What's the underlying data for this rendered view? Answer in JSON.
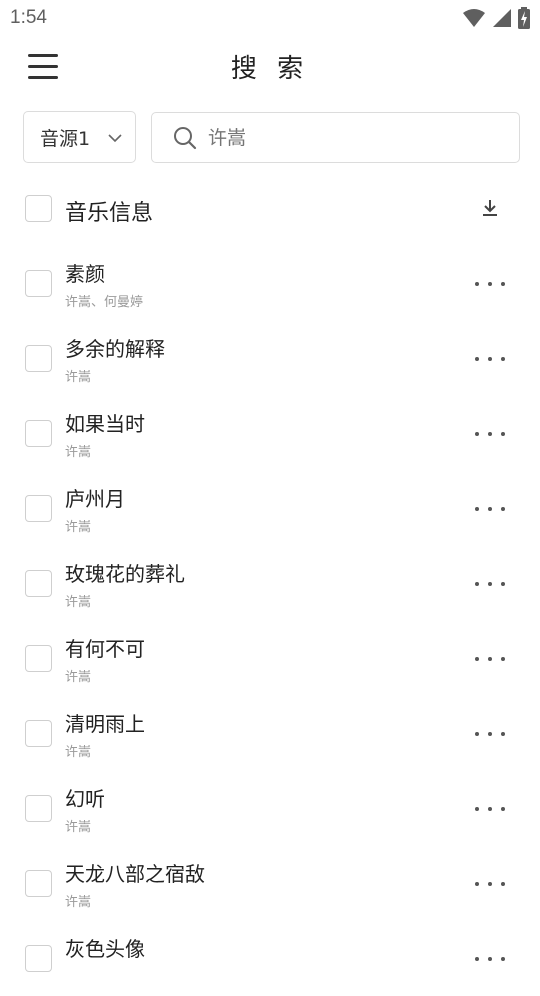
{
  "status_bar": {
    "time": "1:54",
    "icons": [
      "wifi-icon",
      "cellular-signal-icon",
      "battery-charging-icon"
    ]
  },
  "header": {
    "title": "搜 索",
    "menu_icon": "hamburger-menu-icon"
  },
  "search": {
    "source_label": "音源1",
    "placeholder": "许嵩",
    "value": ""
  },
  "list_header": {
    "title": "音乐信息",
    "download_icon": "download-icon"
  },
  "songs": [
    {
      "title": "素颜",
      "artist": "许嵩、何曼婷"
    },
    {
      "title": "多余的解释",
      "artist": "许嵩"
    },
    {
      "title": "如果当时",
      "artist": "许嵩"
    },
    {
      "title": "庐州月",
      "artist": "许嵩"
    },
    {
      "title": "玫瑰花的葬礼",
      "artist": "许嵩"
    },
    {
      "title": "有何不可",
      "artist": "许嵩"
    },
    {
      "title": "清明雨上",
      "artist": "许嵩"
    },
    {
      "title": "幻听",
      "artist": "许嵩"
    },
    {
      "title": "天龙八部之宿敌",
      "artist": "许嵩"
    },
    {
      "title": "灰色头像",
      "artist": ""
    }
  ],
  "colors": {
    "border": "#dcdcdc",
    "text_primary": "#222222",
    "text_secondary": "#9a9a9a"
  }
}
